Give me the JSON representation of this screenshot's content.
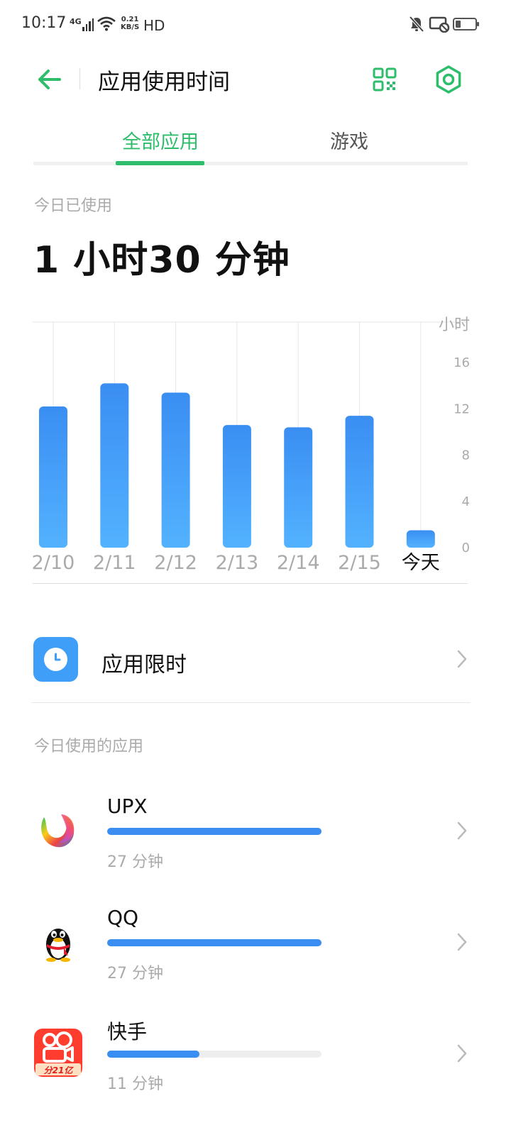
{
  "status": {
    "time": "10:17",
    "network": "4G",
    "speed_value": "0.21",
    "speed_unit": "KB/S",
    "hd": "HD"
  },
  "header": {
    "title": "应用使用时间"
  },
  "tabs": [
    {
      "label": "全部应用",
      "active": true
    },
    {
      "label": "游戏",
      "active": false
    }
  ],
  "summary": {
    "label": "今日已使用",
    "total": "1 小时30 分钟"
  },
  "chart_data": {
    "type": "bar",
    "categories": [
      "2/10",
      "2/11",
      "2/12",
      "2/13",
      "2/14",
      "2/15",
      "今天"
    ],
    "values": [
      12.2,
      14.2,
      13.4,
      10.6,
      10.4,
      11.4,
      1.5
    ],
    "ylabel": "小时",
    "yticks": [
      0,
      4,
      8,
      12,
      16
    ],
    "ylim": [
      0,
      19.5
    ],
    "highlight_category": "今天",
    "bar_color_top": "#3a8ef2",
    "bar_color_bottom": "#53b2ff"
  },
  "app_limit": {
    "label": "应用限时"
  },
  "apps_section": {
    "label": "今日使用的应用"
  },
  "apps": [
    {
      "name": "UPX",
      "time": "27 分钟",
      "fraction": 1.0,
      "icon": "upx-icon"
    },
    {
      "name": "QQ",
      "time": "27 分钟",
      "fraction": 1.0,
      "icon": "qq-penguin-icon"
    },
    {
      "name": "快手",
      "time": "11 分钟",
      "fraction": 0.43,
      "icon": "kuaishou-icon",
      "badge": "分21亿"
    }
  ],
  "colors": {
    "accent_green": "#2ebd6b",
    "bar_blue": "#3a8ef2",
    "limit_icon_blue": "#3f9ef7",
    "kuaishou_red": "#ff3d2e"
  }
}
